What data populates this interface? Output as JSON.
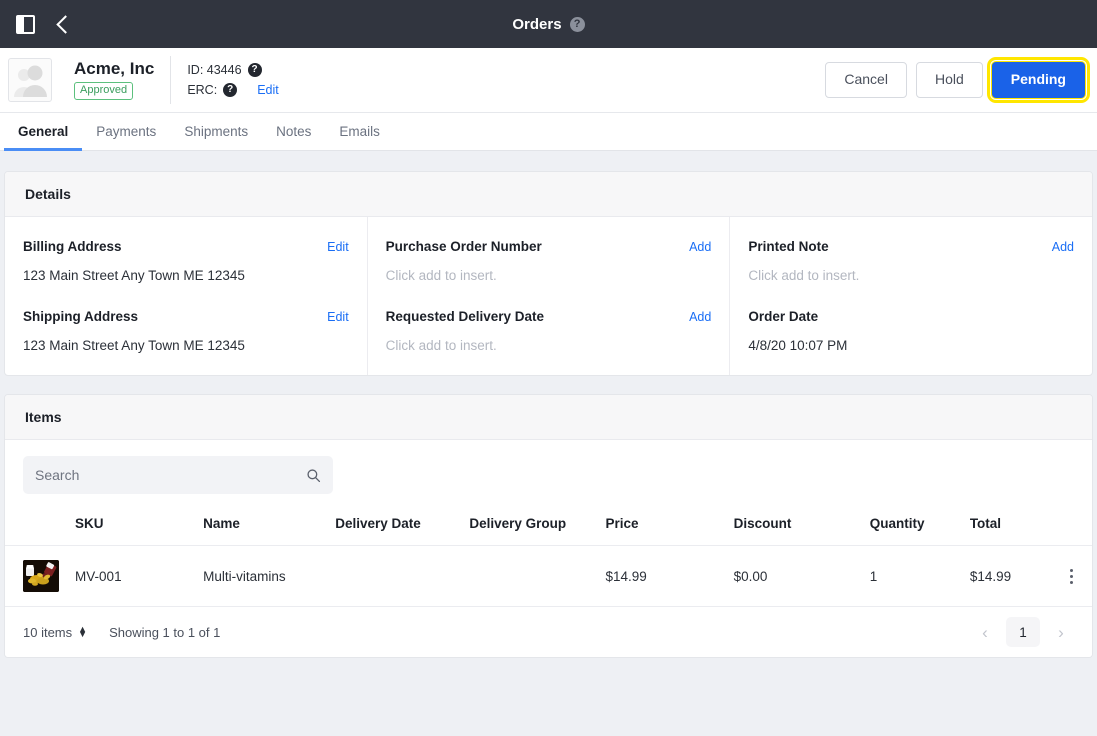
{
  "topbar": {
    "title": "Orders",
    "help_icon": "help-circle-icon",
    "sidebar_toggle_icon": "sidebar-toggle-icon",
    "back_icon": "chevron-left-icon"
  },
  "customer": {
    "avatar_icon": "user-placeholder-avatar",
    "name": "Acme, Inc",
    "status_badge": "Approved",
    "id_label": "ID: 43446",
    "erc_label": "ERC:",
    "edit_link": "Edit",
    "buttons": {
      "cancel": "Cancel",
      "hold": "Hold",
      "status": "Pending"
    }
  },
  "tabs": [
    {
      "label": "General",
      "active": true
    },
    {
      "label": "Payments",
      "active": false
    },
    {
      "label": "Shipments",
      "active": false
    },
    {
      "label": "Notes",
      "active": false
    },
    {
      "label": "Emails",
      "active": false
    }
  ],
  "details": {
    "title": "Details",
    "columns": [
      {
        "fields": [
          {
            "label": "Billing Address",
            "action": "Edit",
            "value": "123 Main Street Any Town ME 12345",
            "muted": false
          },
          {
            "label": "Shipping Address",
            "action": "Edit",
            "value": "123 Main Street Any Town ME 12345",
            "muted": false
          }
        ]
      },
      {
        "fields": [
          {
            "label": "Purchase Order Number",
            "action": "Add",
            "value": "Click add to insert.",
            "muted": true
          },
          {
            "label": "Requested Delivery Date",
            "action": "Add",
            "value": "Click add to insert.",
            "muted": true
          }
        ]
      },
      {
        "fields": [
          {
            "label": "Printed Note",
            "action": "Add",
            "value": "Click add to insert.",
            "muted": true
          },
          {
            "label": "Order Date",
            "action": "",
            "value": "4/8/20 10:07 PM",
            "muted": false
          }
        ]
      }
    ]
  },
  "items": {
    "title": "Items",
    "search_placeholder": "Search",
    "search_value": "",
    "search_icon": "search-icon",
    "columns": [
      "SKU",
      "Name",
      "Delivery Date",
      "Delivery Group",
      "Price",
      "Discount",
      "Quantity",
      "Total"
    ],
    "rows": [
      {
        "thumb_alt": "multi-vitamins-product-thumbnail",
        "sku": "MV-001",
        "name": "Multi-vitamins",
        "delivery_date": "",
        "delivery_group": "",
        "price": "$14.99",
        "discount": "$0.00",
        "quantity": "1",
        "total": "$14.99"
      }
    ],
    "footer": {
      "per_page": "10 items",
      "showing": "Showing 1 to 1 of 1",
      "prev_icon": "chevron-left-icon",
      "page": "1",
      "next_icon": "chevron-right-icon"
    }
  },
  "colors": {
    "topbar_bg": "#31353f",
    "page_bg": "#eef0f4",
    "primary": "#1a62e8",
    "link": "#1a6ef5",
    "badge_green": "#3a9d5d",
    "highlight_yellow": "#ffe600"
  }
}
